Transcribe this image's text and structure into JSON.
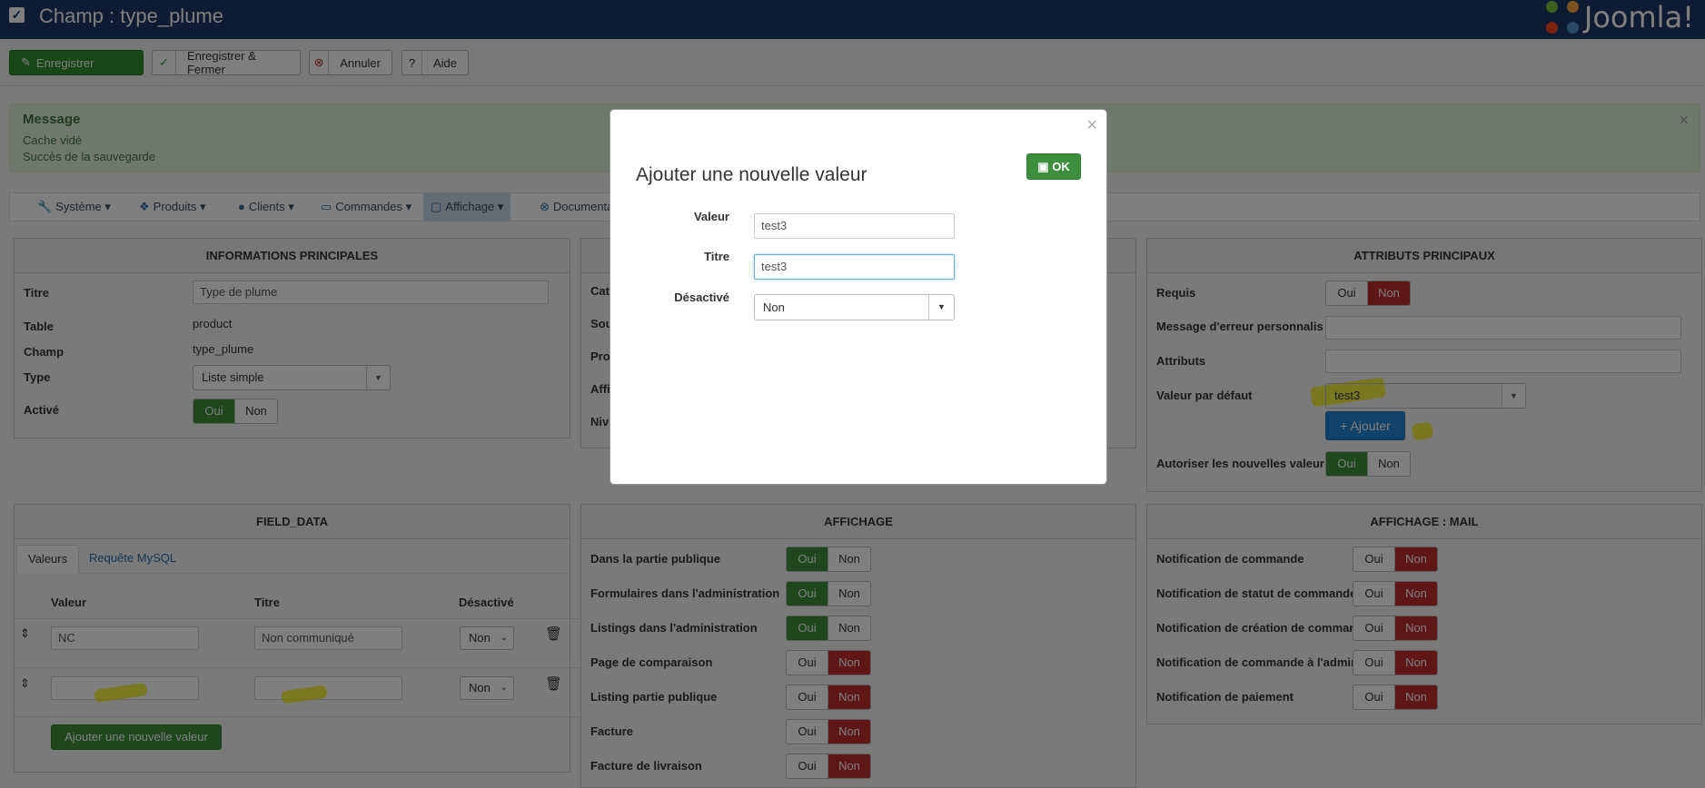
{
  "header": {
    "title": "Champ : type_plume",
    "logo_text": "Joomla!"
  },
  "toolbar": {
    "save": "Enregistrer",
    "save_close": "Enregistrer & Fermer",
    "cancel": "Annuler",
    "help": "Aide"
  },
  "message": {
    "heading": "Message",
    "line1": "Cache vidé",
    "line2": "Succès de la sauvegarde",
    "close": "×"
  },
  "nav": {
    "items": [
      {
        "label": "Système ▾",
        "icon": "wrench-icon"
      },
      {
        "label": "Produits ▾",
        "icon": "cubes-icon"
      },
      {
        "label": "Clients ▾",
        "icon": "user-icon"
      },
      {
        "label": "Commandes ▾",
        "icon": "credit-card-icon"
      },
      {
        "label": "Affichage ▾",
        "icon": "monitor-icon"
      },
      {
        "label": "Documentati",
        "icon": "circle-x-icon"
      }
    ]
  },
  "info": {
    "header": "INFORMATIONS PRINCIPALES",
    "titre_label": "Titre",
    "titre_value": "Type de plume",
    "table_label": "Table",
    "table_value": "product",
    "champ_label": "Champ",
    "champ_value": "type_plume",
    "type_label": "Type",
    "type_value": "Liste simple",
    "active_label": "Activé",
    "oui": "Oui",
    "non": "Non"
  },
  "middle_hidden": {
    "l1": "Cat",
    "l2": "Sou",
    "l3": "Pro",
    "l4": "Affi",
    "l5": "Nive"
  },
  "attrs": {
    "header": "ATTRIBUTS PRINCIPAUX",
    "requis": "Requis",
    "msg_err": "Message d'erreur personnalis",
    "attributs": "Attributs",
    "valeur_defaut": "Valeur par défaut",
    "valeur_defaut_value": "test3",
    "ajouter": "+ Ajouter",
    "autoriser": "Autoriser les nouvelles valeur",
    "oui": "Oui",
    "non": "Non"
  },
  "field_data": {
    "header": "FIELD_DATA",
    "tab_valeurs": "Valeurs",
    "tab_mysql": "Requête MySQL",
    "col_valeur": "Valeur",
    "col_titre": "Titre",
    "col_desactive": "Désactivé",
    "rows": [
      {
        "valeur": "NC",
        "titre": "Non communiqué",
        "desactive": "Non"
      },
      {
        "valeur": "",
        "titre": "",
        "desactive": "Non"
      }
    ],
    "add_button": "Ajouter une nouvelle valeur"
  },
  "affichage": {
    "header": "AFFICHAGE",
    "rows": [
      {
        "label": "Dans la partie publique",
        "state": "oui"
      },
      {
        "label": "Formulaires dans l'administration",
        "state": "oui"
      },
      {
        "label": "Listings dans l'administration",
        "state": "oui"
      },
      {
        "label": "Page de comparaison",
        "state": "non"
      },
      {
        "label": "Listing partie publique",
        "state": "non"
      },
      {
        "label": "Facture",
        "state": "non"
      },
      {
        "label": "Facture de livraison",
        "state": "non"
      }
    ],
    "oui": "Oui",
    "non": "Non"
  },
  "mail": {
    "header": "AFFICHAGE : MAIL",
    "rows": [
      {
        "label": "Notification de commande"
      },
      {
        "label": "Notification de statut de commande"
      },
      {
        "label": "Notification de création de comman"
      },
      {
        "label": "Notification de commande à l'admin"
      },
      {
        "label": "Notification de paiement"
      }
    ],
    "oui": "Oui",
    "non": "Non"
  },
  "modal": {
    "title": "Ajouter une nouvelle valeur",
    "ok": "OK",
    "close": "×",
    "valeur_label": "Valeur",
    "valeur_value": "test3",
    "titre_label": "Titre",
    "titre_value": "test3",
    "desactive_label": "Désactivé",
    "desactive_value": "Non"
  },
  "colors": {
    "header_bg": "#1a3867",
    "green": "#3d8f3d",
    "red": "#bd2c2c",
    "blue": "#2384d3",
    "highlight": "#f0eb00"
  }
}
